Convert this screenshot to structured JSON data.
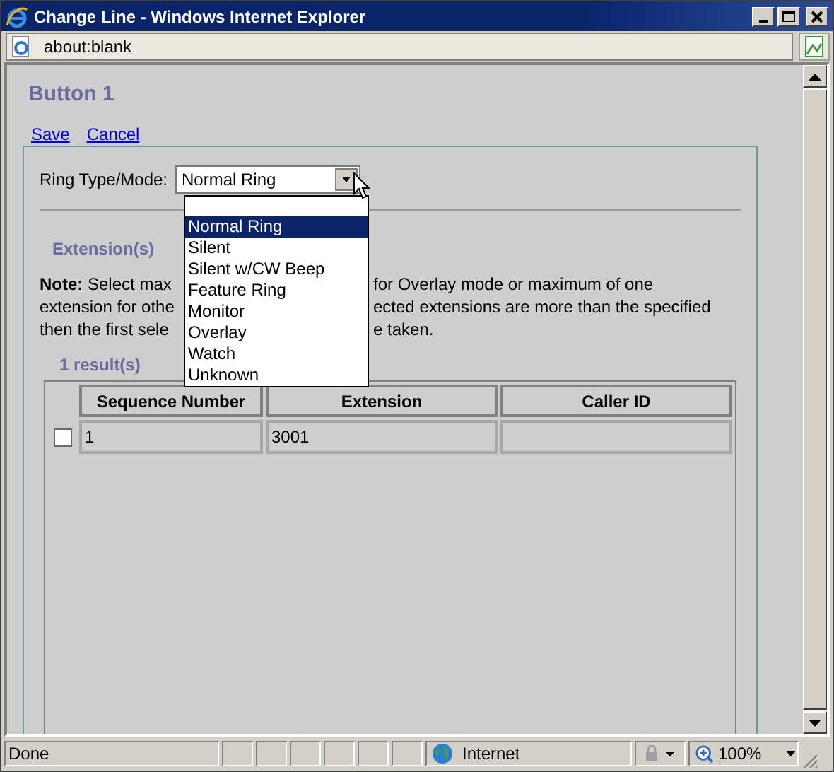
{
  "window": {
    "title": "Change Line - Windows Internet Explorer"
  },
  "address_bar": {
    "url": "about:blank"
  },
  "page": {
    "heading": "Button 1",
    "links": [
      "Save",
      "Cancel"
    ],
    "ring_type": {
      "label": "Ring Type/Mode:",
      "value": "Normal Ring",
      "open": true,
      "options": [
        {
          "label": "Normal Ring",
          "selected": true
        },
        {
          "label": "Silent",
          "selected": false
        },
        {
          "label": "Silent w/CW Beep",
          "selected": false
        },
        {
          "label": "Feature Ring",
          "selected": false
        },
        {
          "label": "Monitor",
          "selected": false
        },
        {
          "label": "Overlay",
          "selected": false
        },
        {
          "label": "Watch",
          "selected": false
        },
        {
          "label": "Unknown",
          "selected": false
        }
      ]
    },
    "section_title": "Extension(s)",
    "note_lines": [
      {
        "left": "**Note:** Select max",
        "right": "for Overlay mode or maximum of one"
      },
      {
        "left": "extension for othe",
        "right": "ected extensions are more than the specified"
      },
      {
        "left": "then the first sele",
        "right": "e taken."
      }
    ],
    "result_count": "1 result(s)",
    "table": {
      "columns": [
        "Sequence Number",
        "Extension",
        "Caller ID"
      ],
      "rows": [
        {
          "checked": false,
          "cells": [
            "1",
            "3001"
          ]
        }
      ]
    }
  },
  "status_bar": {
    "text": "Done",
    "zone": "Internet",
    "zoom": "100%"
  }
}
